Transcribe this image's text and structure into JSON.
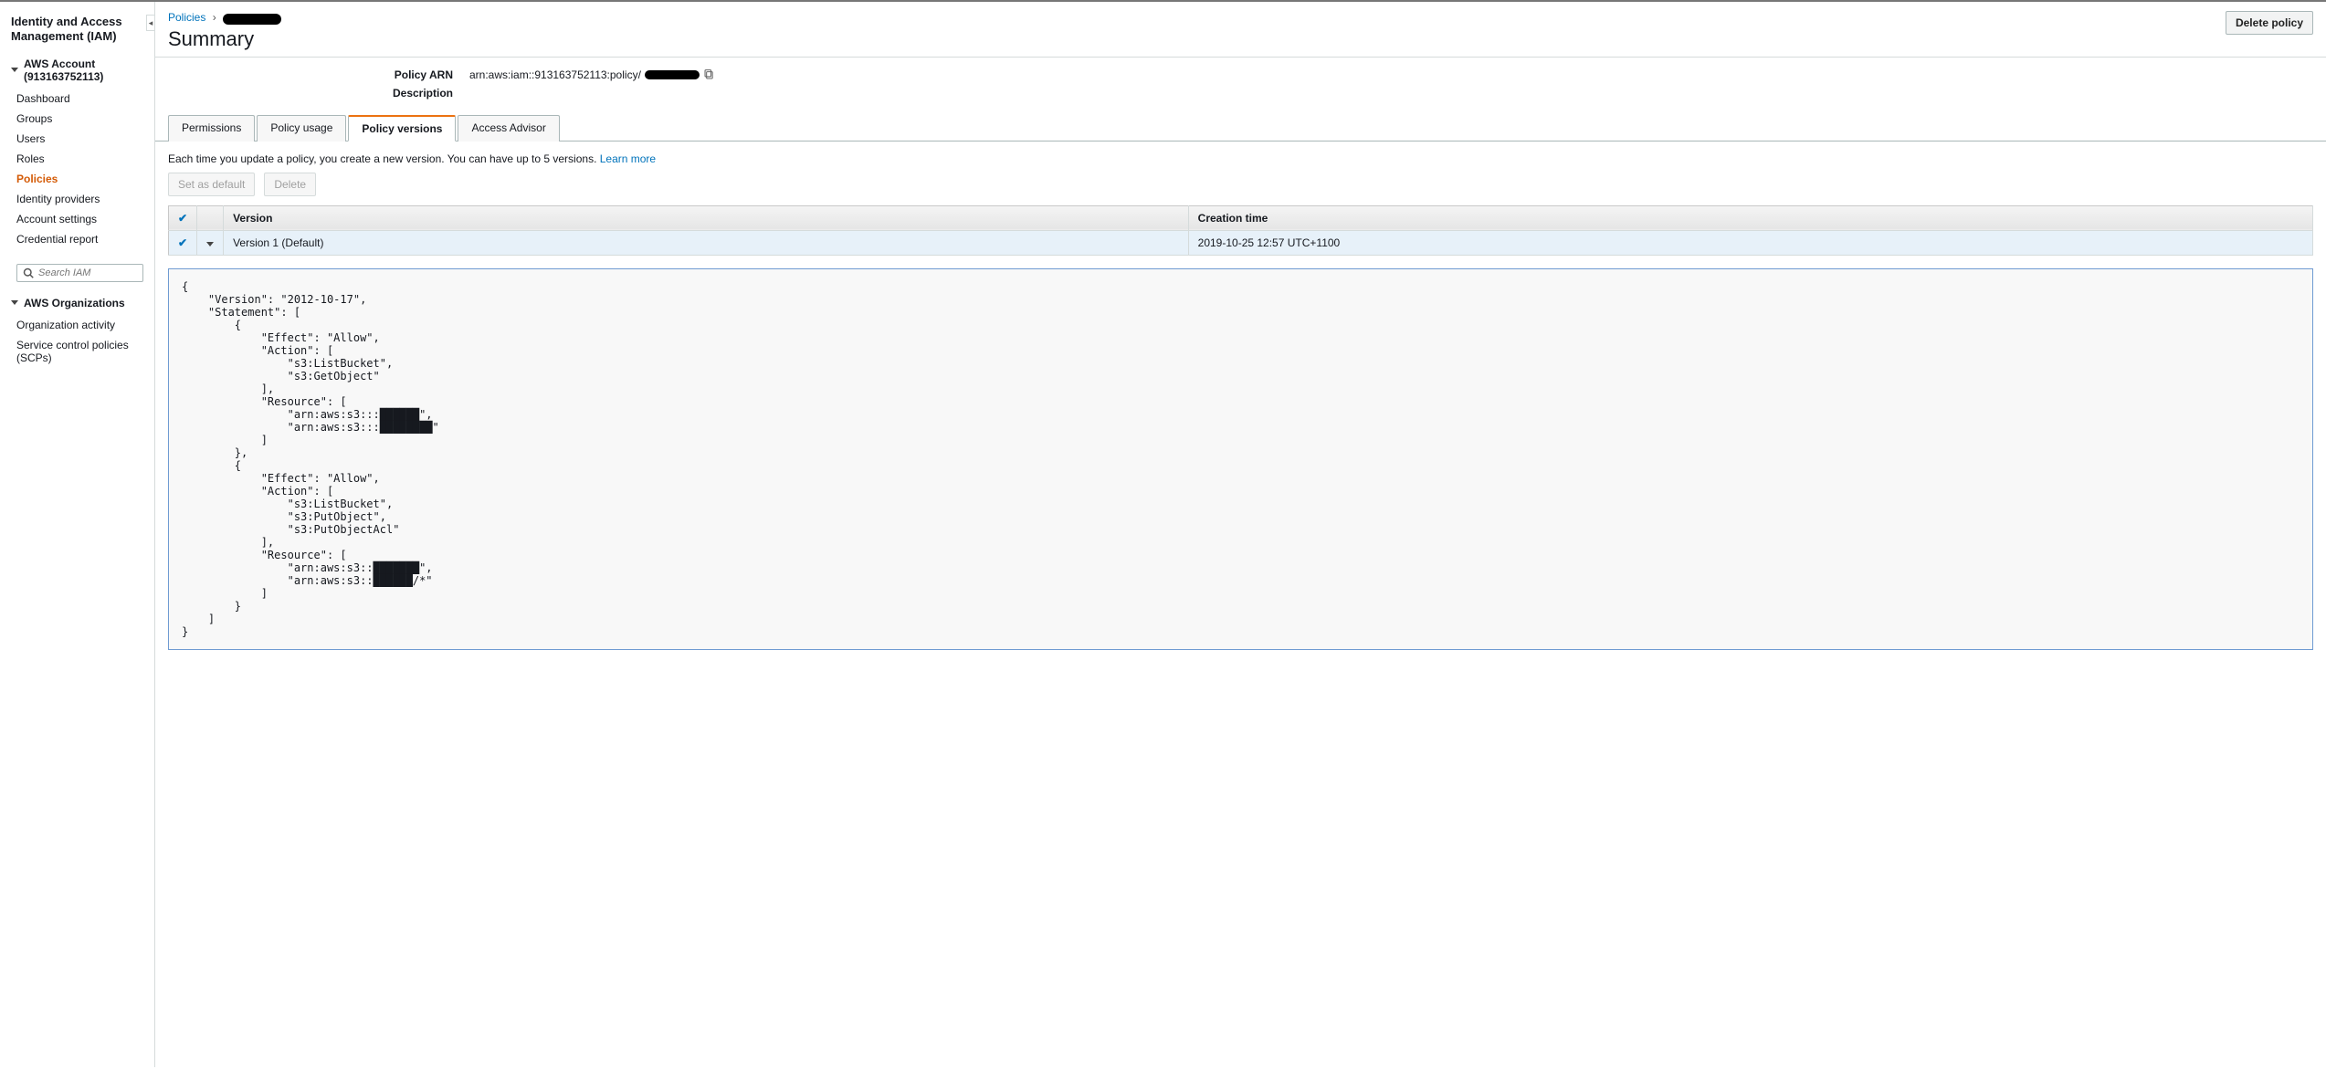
{
  "sidebar": {
    "title": "Identity and Access Management (IAM)",
    "account_section": "AWS Account (913163752113)",
    "items": [
      {
        "label": "Dashboard"
      },
      {
        "label": "Groups"
      },
      {
        "label": "Users"
      },
      {
        "label": "Roles"
      },
      {
        "label": "Policies",
        "active": true
      },
      {
        "label": "Identity providers"
      },
      {
        "label": "Account settings"
      },
      {
        "label": "Credential report"
      }
    ],
    "search_placeholder": "Search IAM",
    "org_section": "AWS Organizations",
    "org_items": [
      {
        "label": "Organization activity"
      },
      {
        "label": "Service control policies (SCPs)"
      }
    ]
  },
  "breadcrumb": {
    "root": "Policies"
  },
  "header": {
    "title": "Summary",
    "delete_btn": "Delete policy"
  },
  "meta": {
    "arn_label": "Policy ARN",
    "arn_value": "arn:aws:iam::913163752113:policy/",
    "desc_label": "Description",
    "desc_value": ""
  },
  "tabs": [
    {
      "label": "Permissions"
    },
    {
      "label": "Policy usage"
    },
    {
      "label": "Policy versions",
      "active": true
    },
    {
      "label": "Access Advisor"
    }
  ],
  "versions_panel": {
    "info": "Each time you update a policy, you create a new version. You can have up to 5 versions. ",
    "learn_more": "Learn more",
    "set_default_btn": "Set as default",
    "delete_btn": "Delete",
    "columns": {
      "version": "Version",
      "creation_time": "Creation time"
    },
    "rows": [
      {
        "version": "Version 1 (Default)",
        "creation": "2019-10-25 12:57 UTC+1100",
        "selected": true
      }
    ],
    "policy_json": "{\n    \"Version\": \"2012-10-17\",\n    \"Statement\": [\n        {\n            \"Effect\": \"Allow\",\n            \"Action\": [\n                \"s3:ListBucket\",\n                \"s3:GetObject\"\n            ],\n            \"Resource\": [\n                \"arn:aws:s3:::██████\",\n                \"arn:aws:s3:::████████\"\n            ]\n        },\n        {\n            \"Effect\": \"Allow\",\n            \"Action\": [\n                \"s3:ListBucket\",\n                \"s3:PutObject\",\n                \"s3:PutObjectAcl\"\n            ],\n            \"Resource\": [\n                \"arn:aws:s3::███████\",\n                \"arn:aws:s3::██████/*\"\n            ]\n        }\n    ]\n}"
  }
}
